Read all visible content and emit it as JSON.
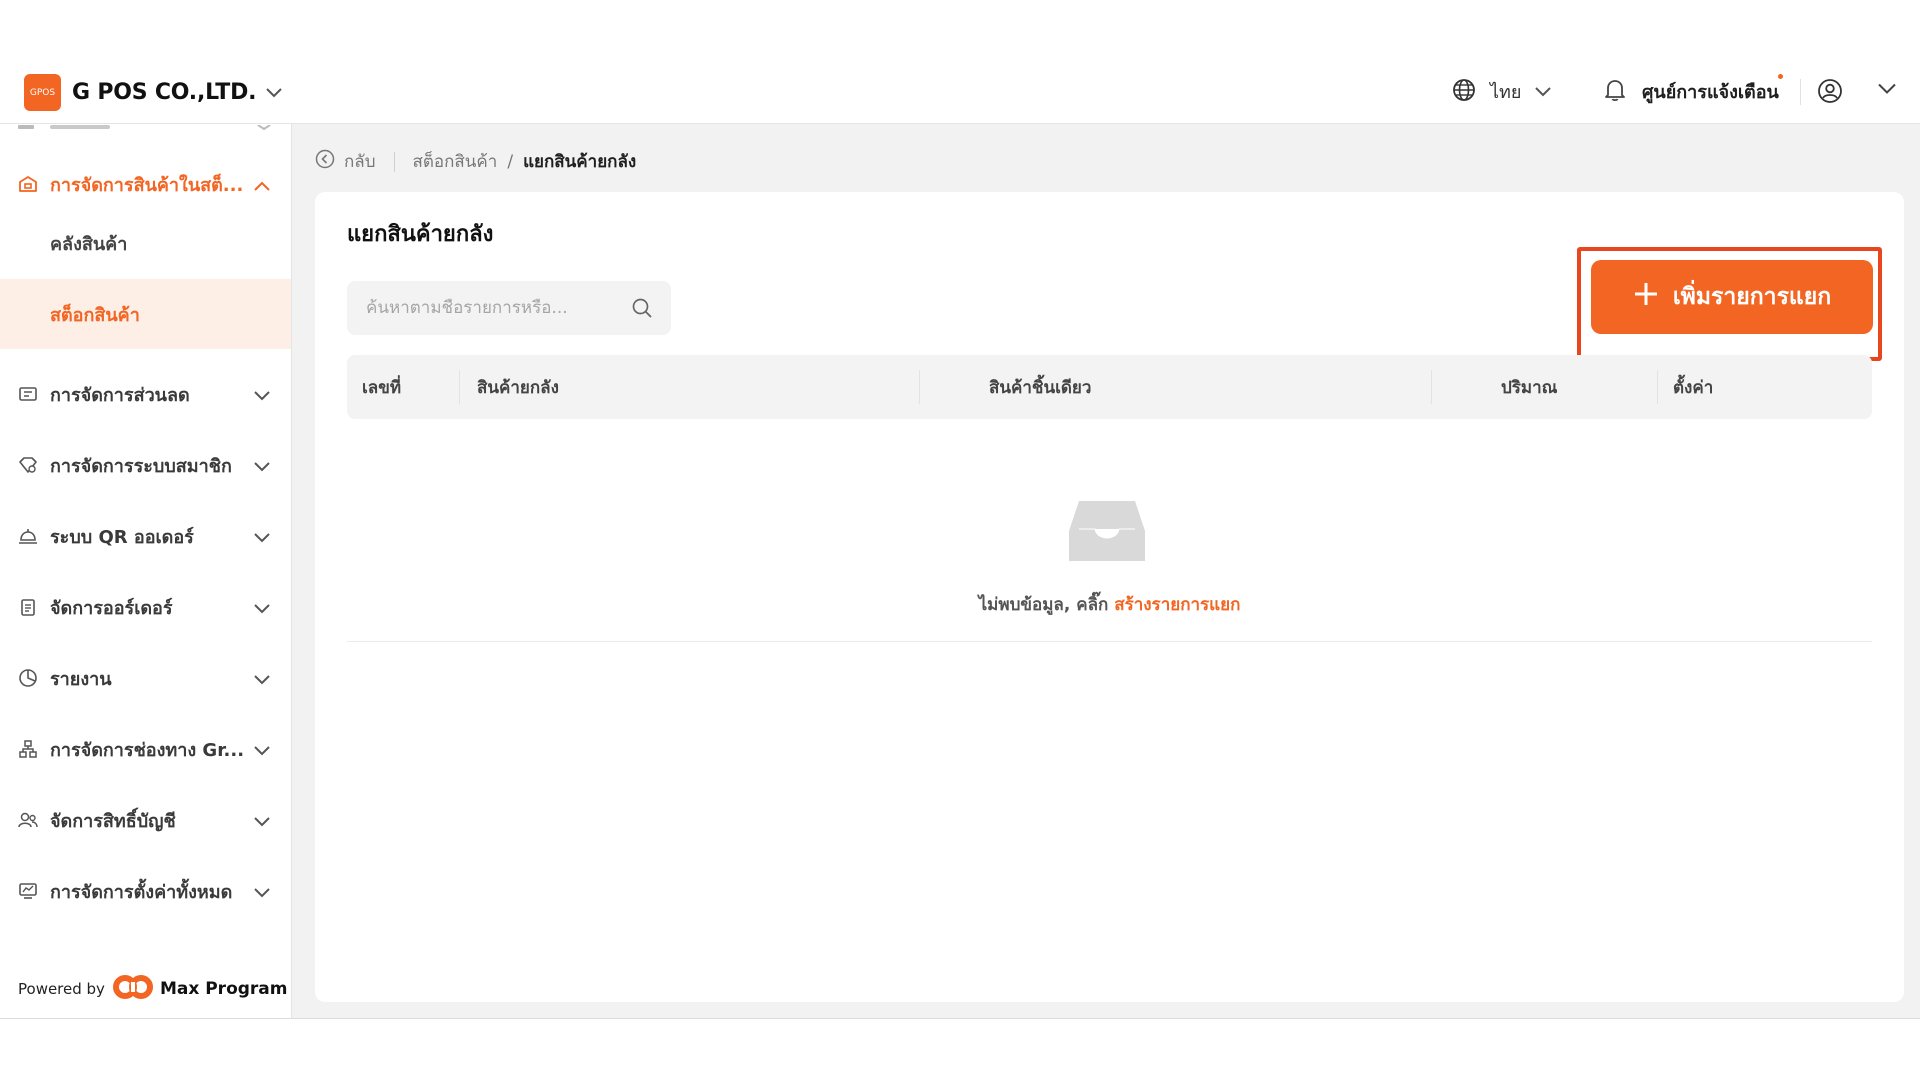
{
  "header": {
    "logo_text": "GPOS",
    "company": "G POS CO.,LTD.",
    "language": "ไทย",
    "notification_center": "ศูนย์การแจ้งเตือน"
  },
  "sidebar": {
    "items": [
      {
        "label": "การจัดการสินค้าในสต็...",
        "icon": "warehouse-icon",
        "expanded": true
      },
      {
        "label": "การจัดการส่วนลด",
        "icon": "discount-icon"
      },
      {
        "label": "การจัดการระบบสมาชิก",
        "icon": "member-diamond-icon"
      },
      {
        "label": "ระบบ QR ออเดอร์",
        "icon": "service-bell-icon"
      },
      {
        "label": "จัดการออร์เดอร์",
        "icon": "clipboard-icon"
      },
      {
        "label": "รายงาน",
        "icon": "pie-chart-icon"
      },
      {
        "label": "การจัดการช่องทาง Gr...",
        "icon": "channel-tree-icon"
      },
      {
        "label": "จัดการสิทธิ์บัญชี",
        "icon": "account-users-icon"
      },
      {
        "label": "การจัดการตั้งค่าทั้งหมด",
        "icon": "settings-monitor-icon"
      }
    ],
    "sub_items": [
      {
        "label": "คลังสินค้า"
      },
      {
        "label": "สต็อกสินค้า",
        "selected": true
      }
    ],
    "powered_by": "Powered by",
    "powered_brand": "Max Program"
  },
  "breadcrumb": {
    "back": "กลับ",
    "parent": "สต็อกสินค้า",
    "current": "แยกสินค้ายกลัง"
  },
  "main": {
    "title": "แยกสินค้ายกลัง",
    "search_placeholder": "ค้นหาตามชื่อรายการหรือ...",
    "add_button": "เพิ่มรายการแยก",
    "columns": [
      "เลขที่",
      "สินค้ายกลัง",
      "สินค้าชิ้นเดียว",
      "ปริมาณ",
      "ตั้งค่า"
    ],
    "empty_text": "ไม่พบข้อมูล, คลิ๊ก",
    "empty_link": "สร้างรายการแยก"
  },
  "colors": {
    "accent": "#f26522",
    "highlight_border": "#e8471d",
    "selected_bg": "#fdeee6"
  }
}
